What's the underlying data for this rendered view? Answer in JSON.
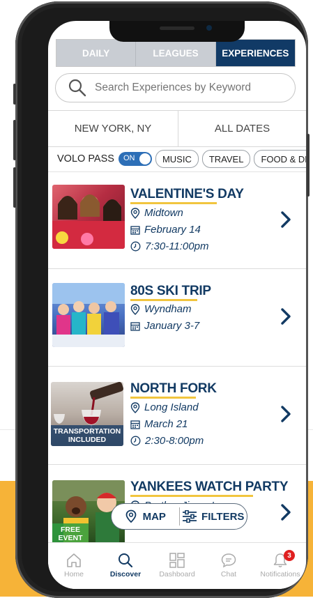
{
  "tabs": [
    "DAILY",
    "LEAGUES",
    "EXPERIENCES"
  ],
  "active_tab": "EXPERIENCES",
  "search": {
    "placeholder": "Search Experiences by Keyword"
  },
  "location": "NEW YORK, NY",
  "dates": "ALL DATES",
  "volo_pass": {
    "label": "VOLO PASS",
    "toggle": "ON"
  },
  "chips": [
    "MUSIC",
    "TRAVEL",
    "FOOD & DR"
  ],
  "events": [
    {
      "title": "VALENTINE'S DAY",
      "location": "Midtown",
      "date": "February 14",
      "time": "7:30-11:00pm",
      "thumb_color": "#c2394a"
    },
    {
      "title": "80S SKI TRIP",
      "location": "Wyndham",
      "date": "January 3-7",
      "thumb_color": "#3a5fa8"
    },
    {
      "title": "NORTH FORK",
      "location": "Long Island",
      "date": "March 21",
      "time": "2:30-8:00pm",
      "badge": "TRANSPORTATION INCLUDED",
      "thumb_color": "#9a8f86"
    },
    {
      "title": "YANKEES WATCH PARTY",
      "location": "Brother Jimmy's",
      "badge": "FREE EVENT",
      "thumb_color": "#4c7f3a"
    }
  ],
  "float_buttons": {
    "map": "MAP",
    "filters": "FILTERS"
  },
  "nav": [
    {
      "label": "Home",
      "icon": "home-icon"
    },
    {
      "label": "Discover",
      "icon": "search-icon"
    },
    {
      "label": "Dashboard",
      "icon": "dashboard-icon"
    },
    {
      "label": "Chat",
      "icon": "chat-icon"
    },
    {
      "label": "Notifications",
      "icon": "bell-icon",
      "badge": "3"
    }
  ],
  "colors": {
    "navy": "#113a66",
    "accent_yellow": "#f1c53e",
    "orange_bg": "#f6b338",
    "badge_red": "#e02020"
  }
}
